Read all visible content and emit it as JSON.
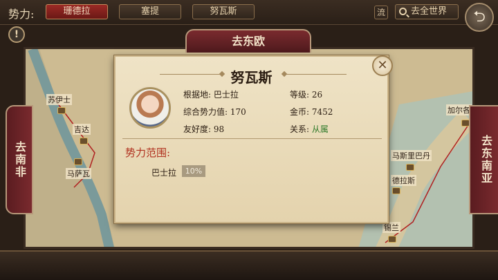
{
  "topbar": {
    "faction_label": "势力:",
    "tabs": [
      "珊德拉",
      "塞提",
      "努瓦斯"
    ],
    "active_tab": 0,
    "flow_label": "流",
    "world_label": "去全世界",
    "back_icon": "back-arrow-icon",
    "alert_icon": "exclamation-icon"
  },
  "nav": {
    "top": "去东欧",
    "left": "去南非",
    "right": "去东南亚"
  },
  "map": {
    "cities": [
      "苏伊士",
      "吉达",
      "马萨瓦",
      "加尔各",
      "马斯里巴丹",
      "德拉斯",
      "锡兰"
    ],
    "route_color": "#b02020"
  },
  "dialog": {
    "title": "努瓦斯",
    "base_label": "根据地:",
    "base_value": "巴士拉",
    "power_label": "综合势力值:",
    "power_value": "170",
    "friend_label": "友好度:",
    "friend_value": "98",
    "level_label": "等级:",
    "level_value": "26",
    "gold_label": "金币:",
    "gold_value": "7452",
    "relation_label": "关系:",
    "relation_value": "从属",
    "territory_title": "势力范围:",
    "territories": [
      {
        "name": "巴士拉",
        "share": "10%",
        "fraction": 0.1
      }
    ],
    "close_icon": "close-icon"
  }
}
